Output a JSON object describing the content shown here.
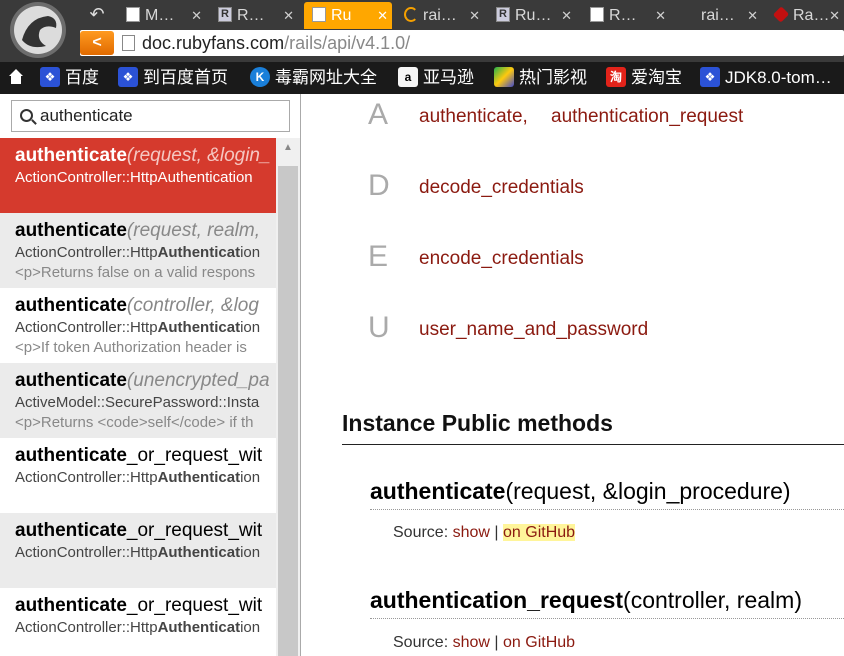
{
  "browser": {
    "tabs": [
      {
        "label": "M…",
        "icon": "page-icon"
      },
      {
        "label": "R…",
        "icon": "r-icon"
      },
      {
        "label": "Ru",
        "icon": "page-icon",
        "active": true
      },
      {
        "label": "rai…",
        "icon": "loading-icon"
      },
      {
        "label": "Ru…",
        "icon": "r-icon"
      },
      {
        "label": "R…",
        "icon": "page-icon"
      },
      {
        "label": "rai…",
        "icon": "blank-icon"
      },
      {
        "label": "Ra…",
        "icon": "ruby-gem-icon"
      }
    ],
    "url_host": "doc.rubyfans.com",
    "url_path": "/rails/api/v4.1.0/",
    "bookmarks": [
      {
        "label": "",
        "icon": "home-icon"
      },
      {
        "label": "百度",
        "icon": "baidu-paw-icon"
      },
      {
        "label": "到百度首页",
        "icon": "baidu-paw-icon"
      },
      {
        "label": "毒霸网址大全",
        "icon": "k-icon"
      },
      {
        "label": "亚马逊",
        "icon": "amazon-icon"
      },
      {
        "label": "热门影视",
        "icon": "play-icon"
      },
      {
        "label": "爱淘宝",
        "icon": "taobao-icon"
      },
      {
        "label": "JDK8.0-tom…",
        "icon": "baidu-paw-icon"
      }
    ],
    "accent_color": "#ffa700"
  },
  "search": {
    "value": "authenticate",
    "results": [
      {
        "name": "authenticate",
        "suffix": "",
        "params": "(request, &login_",
        "ns_pre": "ActionController::HttpAuthentication",
        "ns_bold": "",
        "ns_post": "",
        "desc": ""
      },
      {
        "name": "authenticate",
        "suffix": "",
        "params": "(request, realm,",
        "ns_pre": "ActionController::Http",
        "ns_bold": "Authenticat",
        "ns_post": "ion",
        "desc": "<p>Returns false on a valid respons"
      },
      {
        "name": "authenticate",
        "suffix": "",
        "params": "(controller, &log",
        "ns_pre": "ActionController::Http",
        "ns_bold": "Authenticat",
        "ns_post": "ion",
        "desc": "<p>If token Authorization header is"
      },
      {
        "name": "authenticate",
        "suffix": "",
        "params": "(unencrypted_pa",
        "ns_pre": "ActiveModel::SecurePassword::Insta",
        "ns_bold": "",
        "ns_post": "",
        "desc": "<p>Returns <code>self</code> if th"
      },
      {
        "name": "authenticate",
        "suffix": "_or_request_wit",
        "params": "",
        "ns_pre": "ActionController::Http",
        "ns_bold": "Authenticat",
        "ns_post": "ion",
        "desc": ""
      },
      {
        "name": "authenticate",
        "suffix": "_or_request_wit",
        "params": "",
        "ns_pre": "ActionController::Http",
        "ns_bold": "Authenticat",
        "ns_post": "ion",
        "desc": ""
      },
      {
        "name": "authenticate",
        "suffix": "_or_request_wit",
        "params": "",
        "ns_pre": "ActionController::Http",
        "ns_bold": "Authenticat",
        "ns_post": "ion",
        "desc": ""
      }
    ]
  },
  "index": [
    {
      "letter": "A",
      "methods": [
        "authenticate,",
        "authentication_request"
      ]
    },
    {
      "letter": "D",
      "methods": [
        "decode_credentials"
      ]
    },
    {
      "letter": "E",
      "methods": [
        "encode_credentials"
      ]
    },
    {
      "letter": "U",
      "methods": [
        "user_name_and_password"
      ]
    }
  ],
  "section_title": "Instance Public methods",
  "methods": [
    {
      "name": "authenticate",
      "params": "(request, &login_procedure)",
      "source_label": "Source:",
      "show": "show",
      "sep": "|",
      "github": "on GitHub",
      "github_highlighted": true
    },
    {
      "name": "authentication_request",
      "params": "(controller, realm)",
      "source_label": "Source:",
      "show": "show",
      "sep": "|",
      "github": "on GitHub",
      "github_highlighted": false
    }
  ],
  "colors": {
    "link": "#8b1a10",
    "selected_result": "#d53a2d",
    "highlight": "#fff59a"
  }
}
